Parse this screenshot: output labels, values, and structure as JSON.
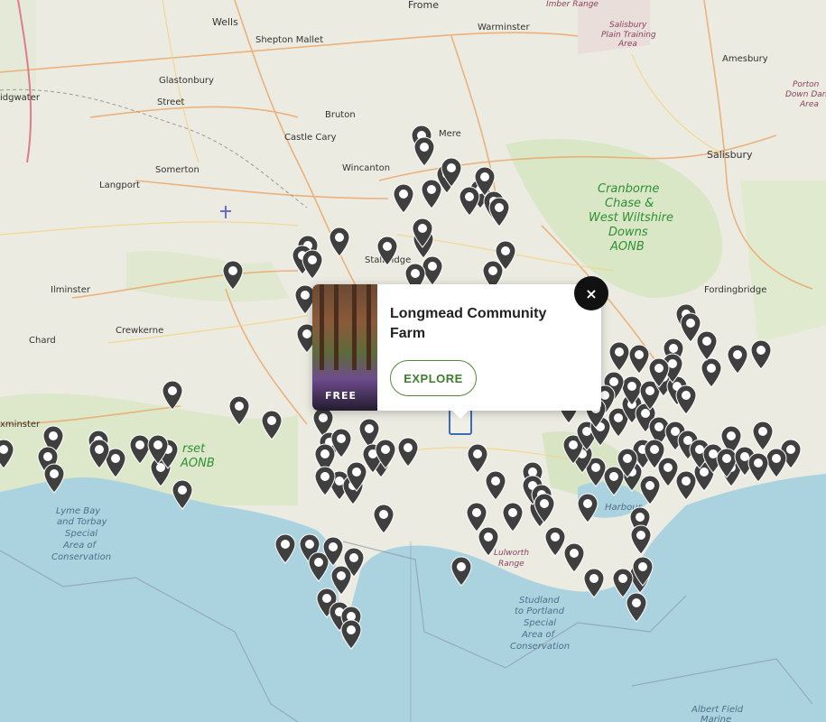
{
  "map": {
    "places": {
      "frome": "Frome",
      "imber_range": "Imber Range",
      "salisbury_plain": [
        "Salisbury",
        "Plain Training",
        "Area"
      ],
      "wells": "Wells",
      "shepton_mallet": "Shepton Mallet",
      "warminster": "Warminster",
      "amesbury": "Amesbury",
      "porton_down": [
        "Porton",
        "Down Dang",
        "Area"
      ],
      "glastonbury": "Glastonbury",
      "street": "Street",
      "bridgwater": "idgwater",
      "bruton": "Bruton",
      "castle_cary": "Castle Cary",
      "mere": "Mere",
      "salisbury": "Salisbury",
      "somerton": "Somerton",
      "wincanton": "Wincanton",
      "langport": "Langport",
      "cranborne": [
        "Cranborne",
        "Chase &",
        "West Wiltshire",
        "Downs",
        "AONB"
      ],
      "stalbridge": "Stalbridge",
      "ilminster": "Ilminster",
      "crewkerne": "Crewkerne",
      "fordingbridge": "Fordingbridge",
      "chard": "Chard",
      "axminster": "xminster",
      "dorset_aonb": [
        "rset",
        "AONB"
      ],
      "lyme_torbay": [
        "Lyme Bay",
        "and Torbay",
        "Special",
        "Area of",
        "Conservation"
      ],
      "harbour": "Harbour",
      "lulworth": [
        "Lulworth",
        "Range"
      ],
      "studland": [
        "Studland",
        "to Portland",
        "Special",
        "Area of",
        "Conservation"
      ],
      "albert_field": [
        "Albert Field",
        "Marine"
      ]
    },
    "pin_color": "#3f3f3f",
    "pin_icon": "map-marker-icon"
  },
  "popup": {
    "title": "Longmead Community Farm",
    "badge": "FREE",
    "explore_label": "EXPLORE",
    "close_label": "×",
    "accent": "#3d7d2f"
  }
}
